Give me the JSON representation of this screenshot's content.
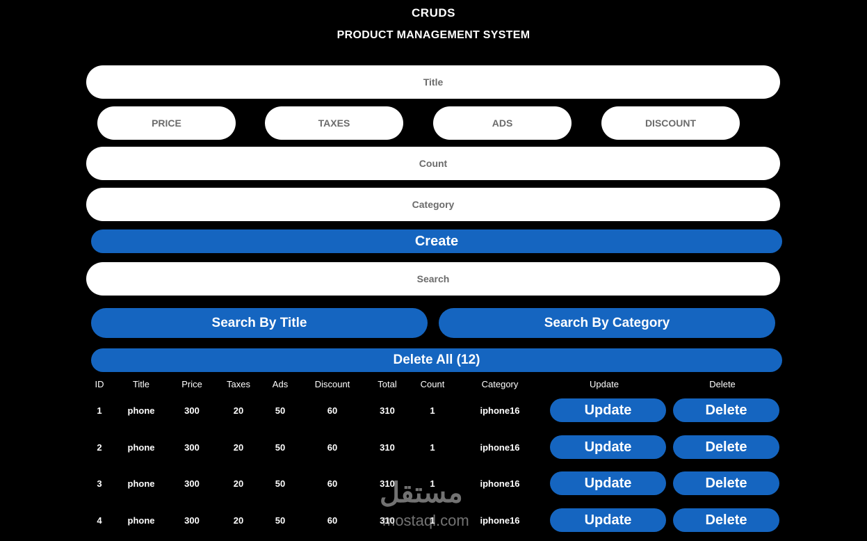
{
  "header": {
    "title": "CRUDS",
    "subtitle": "PRODUCT MANAGEMENT SYSTEM"
  },
  "form": {
    "title_placeholder": "Title",
    "price_placeholder": "PRICE",
    "taxes_placeholder": "TAXES",
    "ads_placeholder": "ADS",
    "discount_placeholder": "DISCOUNT",
    "count_placeholder": "Count",
    "category_placeholder": "Category",
    "create_label": "Create"
  },
  "search": {
    "placeholder": "Search",
    "by_title_label": "Search By Title",
    "by_category_label": "Search By Category"
  },
  "delete_all_label": "Delete All (12)",
  "table": {
    "headers": [
      "ID",
      "Title",
      "Price",
      "Taxes",
      "Ads",
      "Discount",
      "Total",
      "Count",
      "Category",
      "Update",
      "Delete"
    ],
    "rows": [
      {
        "id": "1",
        "title": "phone",
        "price": "300",
        "taxes": "20",
        "ads": "50",
        "discount": "60",
        "total": "310",
        "count": "1",
        "category": "iphone16",
        "update_label": "Update",
        "delete_label": "Delete"
      },
      {
        "id": "2",
        "title": "phone",
        "price": "300",
        "taxes": "20",
        "ads": "50",
        "discount": "60",
        "total": "310",
        "count": "1",
        "category": "iphone16",
        "update_label": "Update",
        "delete_label": "Delete"
      },
      {
        "id": "3",
        "title": "phone",
        "price": "300",
        "taxes": "20",
        "ads": "50",
        "discount": "60",
        "total": "310",
        "count": "1",
        "category": "iphone16",
        "update_label": "Update",
        "delete_label": "Delete"
      },
      {
        "id": "4",
        "title": "phone",
        "price": "300",
        "taxes": "20",
        "ads": "50",
        "discount": "60",
        "total": "310",
        "count": "1",
        "category": "iphone16",
        "update_label": "Update",
        "delete_label": "Delete"
      }
    ]
  },
  "watermark": {
    "arabic": "مستقل",
    "latin": "mostaql.com"
  },
  "colors": {
    "background": "#000000",
    "accent": "#1565c0",
    "field": "#ffffff"
  }
}
